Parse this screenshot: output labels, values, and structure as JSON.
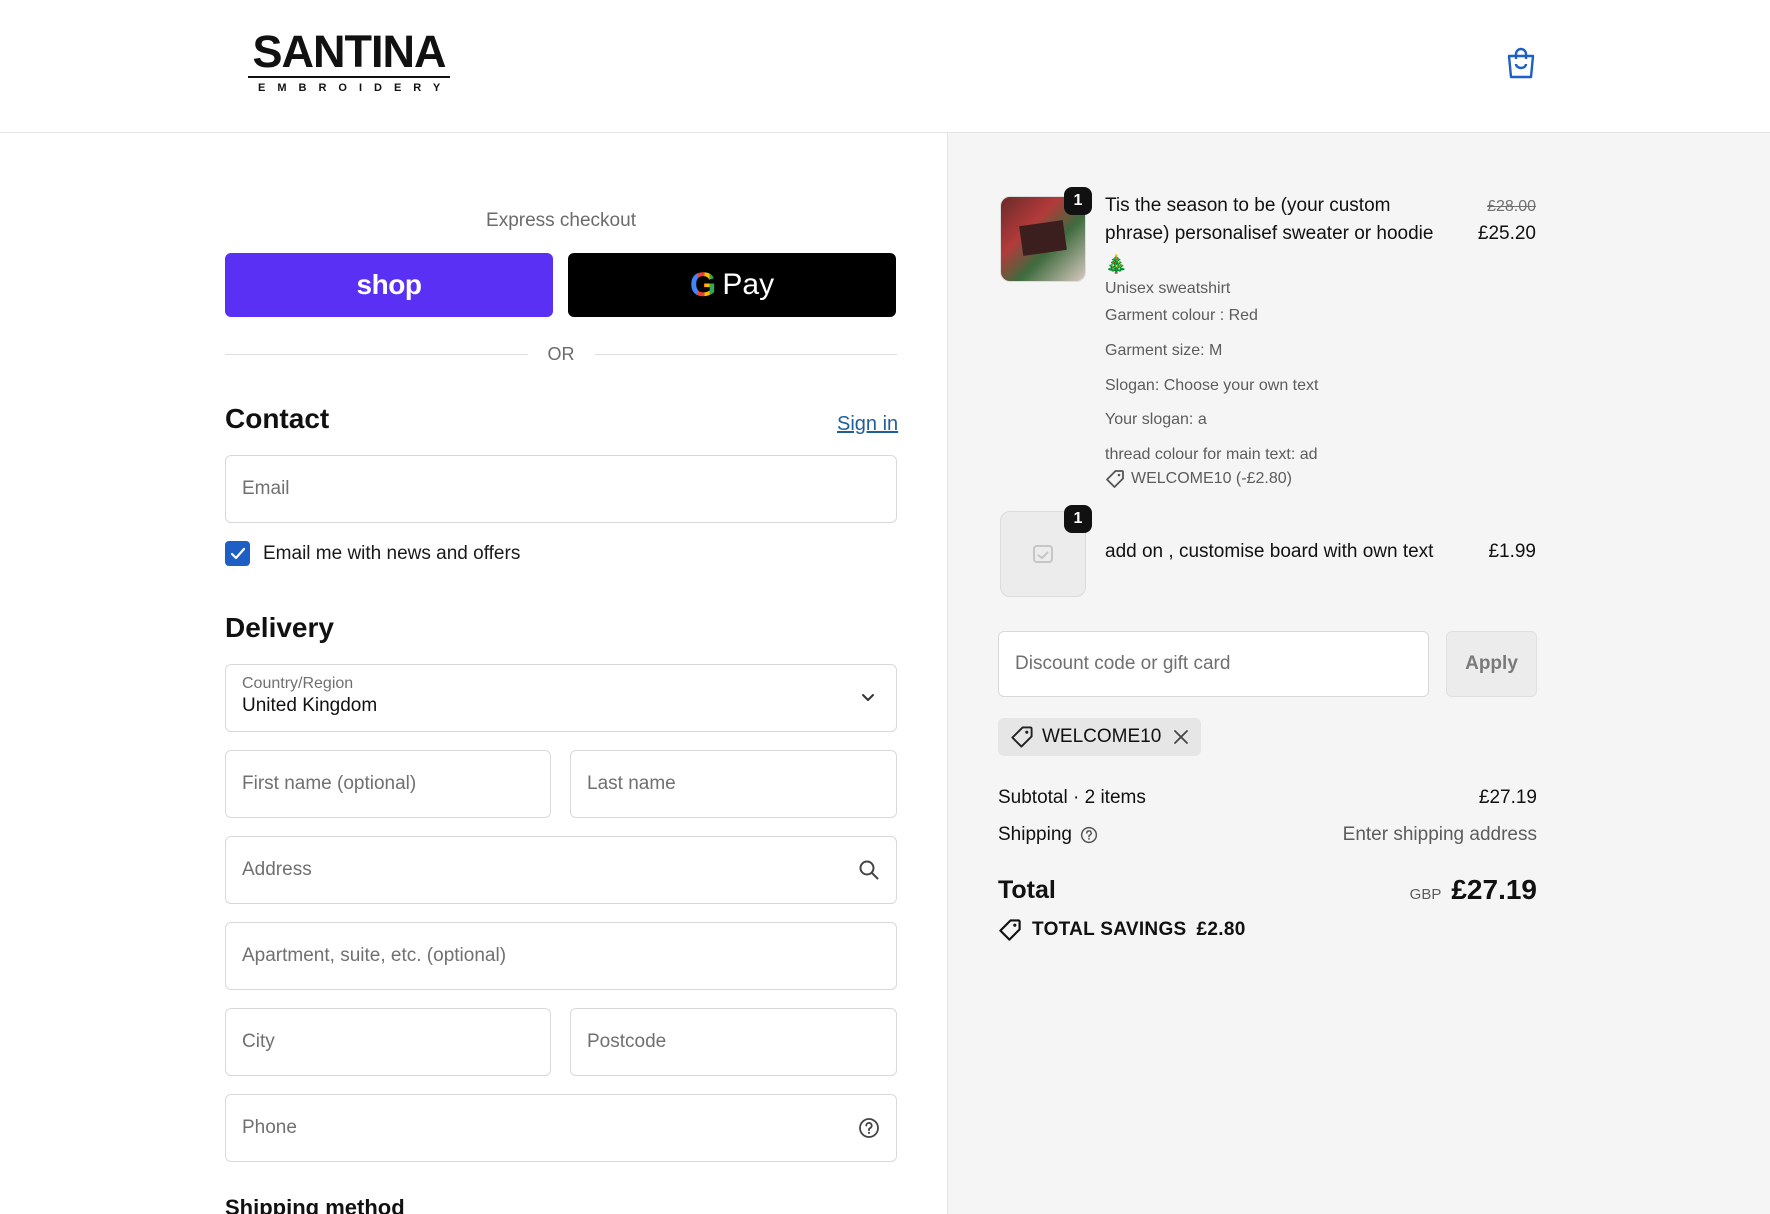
{
  "header": {
    "logo_main": "SANTINA",
    "logo_sub": "EMBROIDERY",
    "cart_icon": "shopping-bag-icon"
  },
  "express": {
    "title": "Express checkout",
    "shop_label": "shop",
    "gpay_g": "G",
    "gpay_label": "Pay",
    "or_label": "OR"
  },
  "contact": {
    "title": "Contact",
    "sign_in": "Sign in",
    "email_placeholder": "Email",
    "newsletter_label": "Email me with news and offers",
    "newsletter_checked": true
  },
  "delivery": {
    "title": "Delivery",
    "country_label": "Country/Region",
    "country_value": "United Kingdom",
    "first_name_placeholder": "First name (optional)",
    "last_name_placeholder": "Last name",
    "address_placeholder": "Address",
    "apartment_placeholder": "Apartment, suite, etc. (optional)",
    "city_placeholder": "City",
    "postcode_placeholder": "Postcode",
    "phone_placeholder": "Phone"
  },
  "shipping_method": {
    "title": "Shipping method"
  },
  "order": {
    "items": [
      {
        "qty": "1",
        "title_line1": "Tis the season to be (your custom",
        "title_line2": "phrase) personalisef sweater or hoodie",
        "emoji": "🎄",
        "variant": "Unisex sweatshirt",
        "options": [
          "Garment colour : Red",
          "Garment size: M",
          "Slogan: Choose your own text",
          "Your slogan: a",
          "thread colour for main text: ad"
        ],
        "discount": "WELCOME10 (-£2.80)",
        "price_old": "£28.00",
        "price": "£25.20"
      },
      {
        "qty": "1",
        "title": "add on , customise board with own text",
        "price": "£1.99"
      }
    ],
    "discount_placeholder": "Discount code or gift card",
    "apply_label": "Apply",
    "applied_code": "WELCOME10",
    "subtotal_label": "Subtotal · 2 items",
    "subtotal_value": "£27.19",
    "shipping_label": "Shipping",
    "shipping_value": "Enter shipping address",
    "total_label": "Total",
    "total_currency": "GBP",
    "total_value": "£27.19",
    "savings_label": "TOTAL SAVINGS",
    "savings_value": "£2.80"
  },
  "colors": {
    "shop_pay": "#5a31f4",
    "link": "#1f5f9e",
    "checkbox": "#1d5fc4"
  }
}
